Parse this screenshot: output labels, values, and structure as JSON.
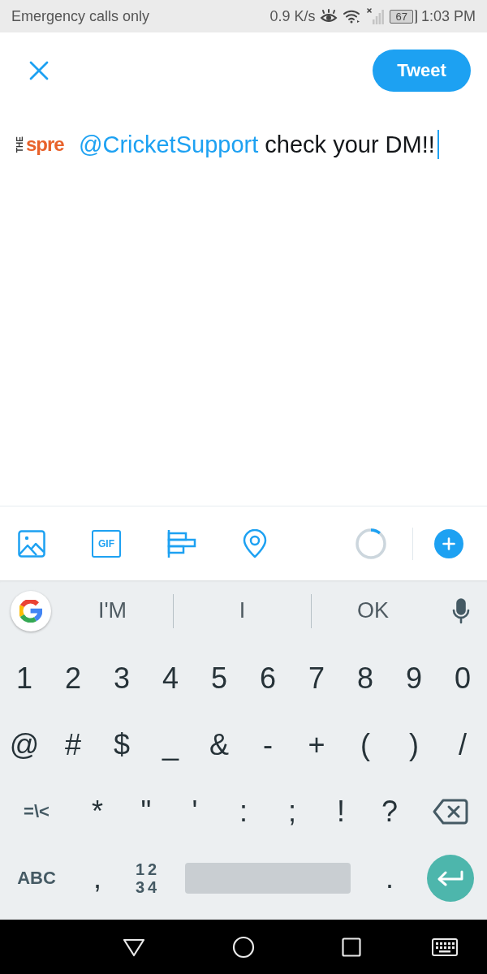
{
  "status_bar": {
    "carrier": "Emergency calls only",
    "speed": "0.9 K/s",
    "battery": "67",
    "time": "1:03 PM"
  },
  "header": {
    "tweet_button": "Tweet"
  },
  "draft": {
    "avatar": {
      "small_text": "THE",
      "brand_text": "spre"
    },
    "focused": true,
    "segments": [
      {
        "kind": "mention",
        "text": "@CricketSupport"
      },
      {
        "kind": "plain",
        "text": "check your DM!!"
      }
    ]
  },
  "toolbar": {
    "items": [
      {
        "kind": "photo"
      },
      {
        "kind": "gif",
        "label": "GIF"
      },
      {
        "kind": "poll"
      },
      {
        "kind": "location"
      }
    ],
    "counter": {
      "level": 0.11
    }
  },
  "keyboard": {
    "suggestions": [
      "I'M",
      "I",
      "OK"
    ],
    "rows": [
      [
        {
          "kind": "char",
          "label": "1"
        },
        {
          "kind": "char",
          "label": "2"
        },
        {
          "kind": "char",
          "label": "3"
        },
        {
          "kind": "char",
          "label": "4"
        },
        {
          "kind": "char",
          "label": "5"
        },
        {
          "kind": "char",
          "label": "6"
        },
        {
          "kind": "char",
          "label": "7"
        },
        {
          "kind": "char",
          "label": "8"
        },
        {
          "kind": "char",
          "label": "9"
        },
        {
          "kind": "char",
          "label": "0"
        }
      ],
      [
        {
          "kind": "char",
          "label": "@"
        },
        {
          "kind": "char",
          "label": "#"
        },
        {
          "kind": "char",
          "label": "$"
        },
        {
          "kind": "char",
          "label": "_"
        },
        {
          "kind": "char",
          "label": "&"
        },
        {
          "kind": "char",
          "label": "-"
        },
        {
          "kind": "char",
          "label": "+"
        },
        {
          "kind": "char",
          "label": "("
        },
        {
          "kind": "char",
          "label": ")"
        },
        {
          "kind": "char",
          "label": "/"
        }
      ],
      [
        {
          "kind": "symbols",
          "label": "=\\<"
        },
        {
          "kind": "char",
          "label": "*"
        },
        {
          "kind": "char",
          "label": "\""
        },
        {
          "kind": "char",
          "label": "'"
        },
        {
          "kind": "char",
          "label": ":"
        },
        {
          "kind": "char",
          "label": ";"
        },
        {
          "kind": "char",
          "label": "!"
        },
        {
          "kind": "char",
          "label": "?"
        },
        {
          "kind": "backspace"
        }
      ],
      [
        {
          "kind": "abc",
          "label": "ABC"
        },
        {
          "kind": "char",
          "label": ","
        },
        {
          "kind": "numpad",
          "lines": [
            "12",
            "34"
          ]
        },
        {
          "kind": "space"
        },
        {
          "kind": "char",
          "label": "."
        },
        {
          "kind": "enter"
        }
      ]
    ]
  }
}
